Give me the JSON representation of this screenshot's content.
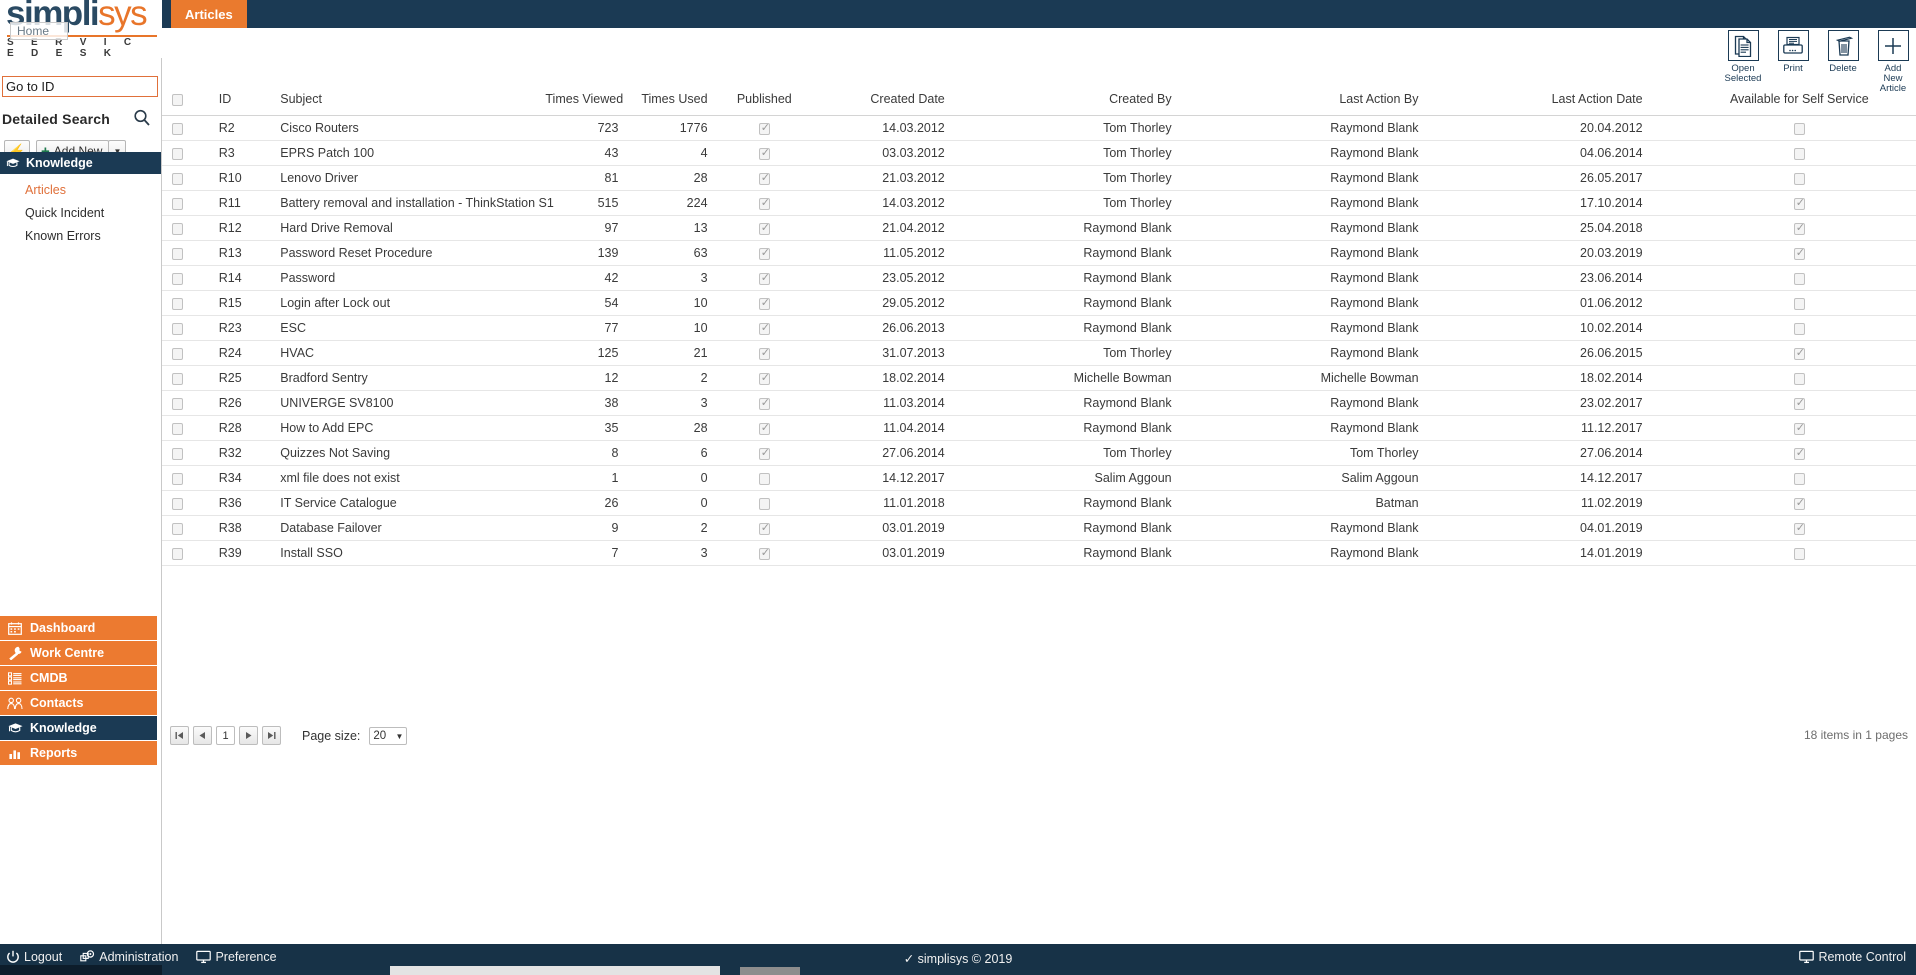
{
  "brand": {
    "name_part1": "simpli",
    "name_part2": "sys",
    "subtitle": "S E R V I C E   D E S K",
    "home_chip": "Home",
    "accent_orange": "#ea7a2e",
    "accent_navy": "#1b3a54"
  },
  "tab": {
    "label": "Articles"
  },
  "sidebar": {
    "goto_value": "Go to ID",
    "goto_placeholder": "Go to ID",
    "detailed_search_label": "Detailed Search",
    "quick_action_label": "",
    "add_new_label": "Add New",
    "section": {
      "label": "Knowledge"
    },
    "sub_items": [
      {
        "label": "Articles",
        "active": true
      },
      {
        "label": "Quick Incident",
        "active": false
      },
      {
        "label": "Known Errors",
        "active": false
      }
    ],
    "main_items": [
      {
        "label": "Dashboard",
        "active": false
      },
      {
        "label": "Work Centre",
        "active": false
      },
      {
        "label": "CMDB",
        "active": false
      },
      {
        "label": "Contacts",
        "active": false
      },
      {
        "label": "Knowledge",
        "active": true
      },
      {
        "label": "Reports",
        "active": false
      }
    ]
  },
  "toolbar": {
    "items": [
      {
        "label": "Open Selected",
        "icon": "documents-icon"
      },
      {
        "label": "Print",
        "icon": "printer-icon"
      },
      {
        "label": "Delete",
        "icon": "trash-icon"
      },
      {
        "label": "Add New Article",
        "icon": "plus-icon"
      }
    ]
  },
  "table": {
    "columns": [
      "",
      "ID",
      "Subject",
      "Times Viewed",
      "Times Used",
      "Published",
      "Created Date",
      "Created By",
      "Last Action By",
      "Last Action Date",
      "Available for Self Service"
    ],
    "rows": [
      {
        "id": "R2",
        "subject": "Cisco Routers",
        "times_viewed": "723",
        "times_used": "1776",
        "published": true,
        "created_date": "14.03.2012",
        "created_by": "Tom Thorley",
        "last_action_by": "Raymond Blank",
        "last_action_date": "20.04.2012",
        "self_service": false
      },
      {
        "id": "R3",
        "subject": "EPRS Patch 100",
        "times_viewed": "43",
        "times_used": "4",
        "published": true,
        "created_date": "03.03.2012",
        "created_by": "Tom Thorley",
        "last_action_by": "Raymond Blank",
        "last_action_date": "04.06.2014",
        "self_service": false
      },
      {
        "id": "R10",
        "subject": "Lenovo Driver",
        "times_viewed": "81",
        "times_used": "28",
        "published": true,
        "created_date": "21.03.2012",
        "created_by": "Tom Thorley",
        "last_action_by": "Raymond Blank",
        "last_action_date": "26.05.2017",
        "self_service": false
      },
      {
        "id": "R11",
        "subject": "Battery removal and installation - ThinkStation S1",
        "times_viewed": "515",
        "times_used": "224",
        "published": true,
        "created_date": "14.03.2012",
        "created_by": "Tom Thorley",
        "last_action_by": "Raymond Blank",
        "last_action_date": "17.10.2014",
        "self_service": true
      },
      {
        "id": "R12",
        "subject": "Hard Drive Removal",
        "times_viewed": "97",
        "times_used": "13",
        "published": true,
        "created_date": "21.04.2012",
        "created_by": "Raymond Blank",
        "last_action_by": "Raymond Blank",
        "last_action_date": "25.04.2018",
        "self_service": true
      },
      {
        "id": "R13",
        "subject": "Password Reset Procedure",
        "times_viewed": "139",
        "times_used": "63",
        "published": true,
        "created_date": "11.05.2012",
        "created_by": "Raymond Blank",
        "last_action_by": "Raymond Blank",
        "last_action_date": "20.03.2019",
        "self_service": true
      },
      {
        "id": "R14",
        "subject": "Password",
        "times_viewed": "42",
        "times_used": "3",
        "published": true,
        "created_date": "23.05.2012",
        "created_by": "Raymond Blank",
        "last_action_by": "Raymond Blank",
        "last_action_date": "23.06.2014",
        "self_service": false
      },
      {
        "id": "R15",
        "subject": "Login after Lock out",
        "times_viewed": "54",
        "times_used": "10",
        "published": true,
        "created_date": "29.05.2012",
        "created_by": "Raymond Blank",
        "last_action_by": "Raymond Blank",
        "last_action_date": "01.06.2012",
        "self_service": false
      },
      {
        "id": "R23",
        "subject": "ESC",
        "times_viewed": "77",
        "times_used": "10",
        "published": true,
        "created_date": "26.06.2013",
        "created_by": "Raymond Blank",
        "last_action_by": "Raymond Blank",
        "last_action_date": "10.02.2014",
        "self_service": false
      },
      {
        "id": "R24",
        "subject": "HVAC",
        "times_viewed": "125",
        "times_used": "21",
        "published": true,
        "created_date": "31.07.2013",
        "created_by": "Tom Thorley",
        "last_action_by": "Raymond Blank",
        "last_action_date": "26.06.2015",
        "self_service": true
      },
      {
        "id": "R25",
        "subject": "Bradford Sentry",
        "times_viewed": "12",
        "times_used": "2",
        "published": true,
        "created_date": "18.02.2014",
        "created_by": "Michelle Bowman",
        "last_action_by": "Michelle Bowman",
        "last_action_date": "18.02.2014",
        "self_service": false
      },
      {
        "id": "R26",
        "subject": "UNIVERGE SV8100",
        "times_viewed": "38",
        "times_used": "3",
        "published": true,
        "created_date": "11.03.2014",
        "created_by": "Raymond Blank",
        "last_action_by": "Raymond Blank",
        "last_action_date": "23.02.2017",
        "self_service": true
      },
      {
        "id": "R28",
        "subject": "How to Add EPC",
        "times_viewed": "35",
        "times_used": "28",
        "published": true,
        "created_date": "11.04.2014",
        "created_by": "Raymond Blank",
        "last_action_by": "Raymond Blank",
        "last_action_date": "11.12.2017",
        "self_service": true
      },
      {
        "id": "R32",
        "subject": "Quizzes Not Saving",
        "times_viewed": "8",
        "times_used": "6",
        "published": true,
        "created_date": "27.06.2014",
        "created_by": "Tom Thorley",
        "last_action_by": "Tom Thorley",
        "last_action_date": "27.06.2014",
        "self_service": true
      },
      {
        "id": "R34",
        "subject": "xml file does not exist",
        "times_viewed": "1",
        "times_used": "0",
        "published": false,
        "created_date": "14.12.2017",
        "created_by": "Salim Aggoun",
        "last_action_by": "Salim Aggoun",
        "last_action_date": "14.12.2017",
        "self_service": false
      },
      {
        "id": "R36",
        "subject": "IT Service Catalogue",
        "times_viewed": "26",
        "times_used": "0",
        "published": false,
        "created_date": "11.01.2018",
        "created_by": "Raymond Blank",
        "last_action_by": "Batman",
        "last_action_date": "11.02.2019",
        "self_service": true
      },
      {
        "id": "R38",
        "subject": "Database Failover",
        "times_viewed": "9",
        "times_used": "2",
        "published": true,
        "created_date": "03.01.2019",
        "created_by": "Raymond Blank",
        "last_action_by": "Raymond Blank",
        "last_action_date": "04.01.2019",
        "self_service": true
      },
      {
        "id": "R39",
        "subject": "Install SSO",
        "times_viewed": "7",
        "times_used": "3",
        "published": true,
        "created_date": "03.01.2019",
        "created_by": "Raymond Blank",
        "last_action_by": "Raymond Blank",
        "last_action_date": "14.01.2019",
        "self_service": false
      }
    ]
  },
  "pager": {
    "first_label": "◀▌",
    "prev_label": "◀",
    "current_page": "1",
    "next_label": "▶",
    "last_label": "▌▶",
    "page_size_label": "Page size:",
    "page_size_value": "20",
    "item_count": "18 items in 1 pages"
  },
  "footer": {
    "logout": "Logout",
    "administration": "Administration",
    "preference": "Preference",
    "copyright": "✓ simplisys © 2019",
    "remote_control": "Remote Control"
  }
}
